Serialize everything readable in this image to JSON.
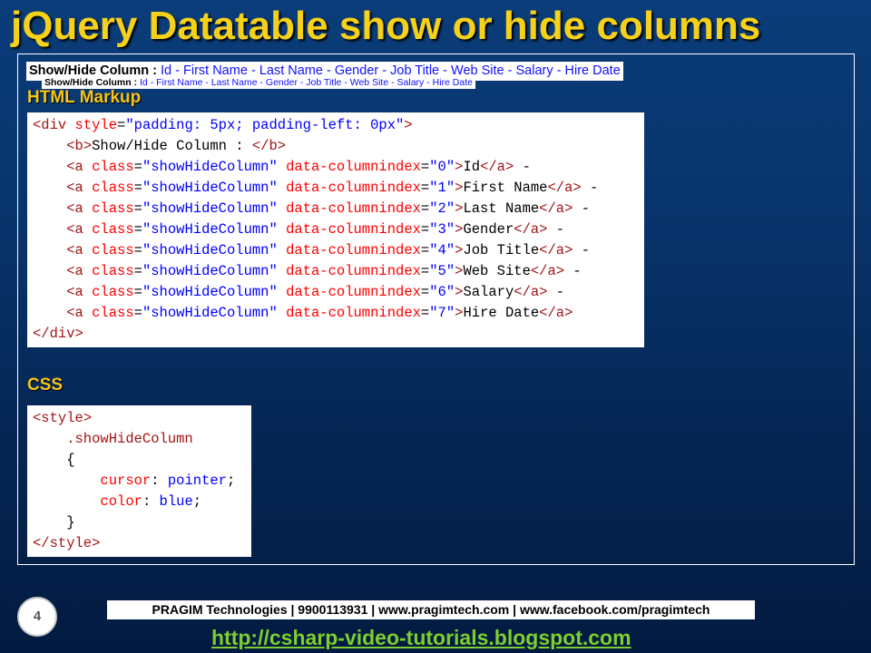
{
  "slide": {
    "title": "jQuery Datatable show or hide columns",
    "page_number": "4"
  },
  "demo": {
    "label": "Show/Hide Column :",
    "separator": "-",
    "links": [
      "Id",
      "First Name",
      "Last Name",
      "Gender",
      "Job Title",
      "Web Site",
      "Salary",
      "Hire Date"
    ]
  },
  "html_section": {
    "heading": "HTML Markup",
    "code": {
      "open_div": [
        "<div ",
        "style",
        "=",
        "\"padding: 5px; padding-left: 0px\"",
        ">"
      ],
      "b_line": [
        "    ",
        "<b>",
        "Show/Hide Column : ",
        "</b>"
      ],
      "anchors": [
        {
          "index": "\"0\"",
          "text": "Id",
          "trail": " -"
        },
        {
          "index": "\"1\"",
          "text": "First Name",
          "trail": " -"
        },
        {
          "index": "\"2\"",
          "text": "Last Name",
          "trail": " -"
        },
        {
          "index": "\"3\"",
          "text": "Gender",
          "trail": " -"
        },
        {
          "index": "\"4\"",
          "text": "Job Title",
          "trail": " -"
        },
        {
          "index": "\"5\"",
          "text": "Web Site",
          "trail": " -"
        },
        {
          "index": "\"6\"",
          "text": "Salary",
          "trail": " -"
        },
        {
          "index": "\"7\"",
          "text": "Hire Date",
          "trail": ""
        }
      ],
      "anchor_parts": {
        "indent": "    ",
        "open": "<a ",
        "class_attr": "class",
        "class_val": "\"showHideColumn\"",
        "idx_attr": "data-columnindex",
        "eq": "=",
        "close_open": ">",
        "close": "</a>"
      },
      "close_div": "</div>"
    }
  },
  "css_section": {
    "heading": "CSS",
    "code": {
      "open_style": "<style>",
      "selector": "    .showHideColumn",
      "open_brace": "    {",
      "decl1_prop": "cursor",
      "decl1_val": "pointer",
      "decl2_prop": "color",
      "decl2_val": "blue",
      "close_brace": "    }",
      "close_style": "</style>"
    }
  },
  "footer": {
    "company": "PRAGIM Technologies | 9900113931 | www.pragimtech.com | www.facebook.com/pragimtech",
    "blog_url": "http://csharp-video-tutorials.blogspot.com"
  },
  "colors": {
    "title": "#f5d11a",
    "heading": "#f5c518",
    "link": "#1010ff",
    "code_tag": "#a31515",
    "code_attr": "#ff0000",
    "code_value": "#0000ff",
    "blog_link": "#7ccf2f"
  }
}
